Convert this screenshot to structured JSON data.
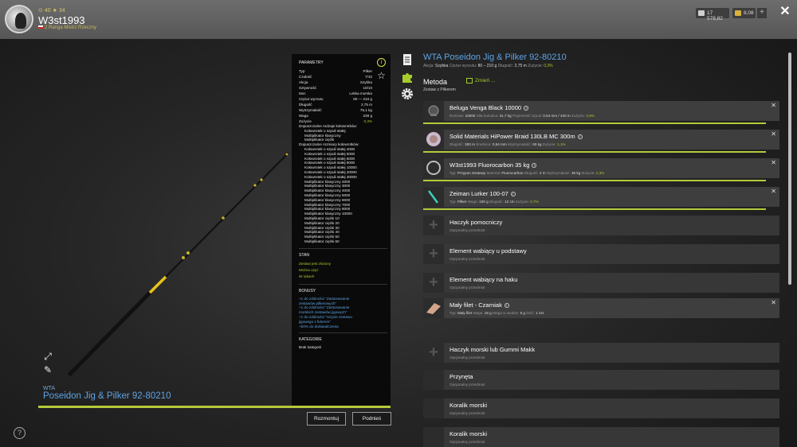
{
  "user": {
    "level_label": "40",
    "stars_label": "34",
    "name": "W3st1993",
    "rank": "2 Ranga Mistrz Rzeczny"
  },
  "currency": {
    "silver": "17 578,82",
    "gold": "8,08",
    "plus": "+"
  },
  "close_label": "✕",
  "rod": {
    "brand": "WTA",
    "name": "Poseidon Jig & Pilker 92-80210"
  },
  "params": {
    "title": "PARAMETRY",
    "rows": [
      {
        "label": "Typ",
        "value": "Pilker"
      },
      {
        "label": "Czułość",
        "value": "7/10"
      },
      {
        "label": "Akcja",
        "value": "Szybka"
      },
      {
        "label": "Sztywność",
        "value": "10/10"
      },
      {
        "label": "Moc",
        "value": "Lekka morska"
      },
      {
        "label": "Ciężar wyrzutu",
        "value": "80 — 210 g"
      },
      {
        "label": "Długość",
        "value": "2,75 m"
      },
      {
        "label": "Wytrzymałość",
        "value": "75,1 kg"
      },
      {
        "label": "Waga",
        "value": "239 g"
      },
      {
        "label": "Zużycie",
        "value": "0,3%",
        "green": true
      }
    ],
    "reels_types_title": "Dopuszczalne rodzaje kołowrotków:",
    "reels_types": [
      "Kołowrotek o szpuli stałej",
      "Multiplikator klasyczny",
      "Multiplikator ciężki"
    ],
    "reels_sizes_title": "Dopuszczalne rozmiary kołowrotków:",
    "reels_sizes": [
      "Kołowrotek o szpuli stałej 4000",
      "Kołowrotek o szpuli stałej 5000",
      "Kołowrotek o szpuli stałej 6000",
      "Kołowrotek o szpuli stałej 8000",
      "Kołowrotek o szpuli stałej 10000",
      "Kołowrotek o szpuli stałej 20000",
      "Kołowrotek o szpuli stałej 30000",
      "Multiplikator klasyczny 2000",
      "Multiplikator klasyczny 3000",
      "Multiplikator klasyczny 4000",
      "Multiplikator klasyczny 5000",
      "Multiplikator klasyczny 6000",
      "Multiplikator klasyczny 7000",
      "Multiplikator klasyczny 8000",
      "Multiplikator klasyczny 10000",
      "Multiplikator ciężki 10",
      "Multiplikator ciężki 20",
      "Multiplikator ciężki 30",
      "Multiplikator ciężki 40",
      "Multiplikator ciężki 50",
      "Multiplikator ciężki 60"
    ],
    "state_title": "STAN",
    "state": [
      "Zestaw jest złożony",
      "Można użyć",
      "W rękach"
    ],
    "bonus_title": "BONUSY",
    "bonus": [
      "+1 do zdolności \"Zastosowanie",
      "zestawów pilkerowych\"",
      "+1 do zdolności \"Zastosowanie",
      "morskich zestawów jigowych\"",
      "+1 do zdolności \"Użycie zestawu",
      "jigowego z fiderem\"",
      "+50% do doświadczenia"
    ],
    "category_title": "KATEGORIE",
    "category": "Brak kategorii"
  },
  "buttons": {
    "disassemble": "Rozmontuj",
    "pick_up": "Podnieś"
  },
  "right": {
    "title": "WTA Poseidon Jig & Pilker 92-80210",
    "sub": {
      "action_label": "Akcja:",
      "action": "Szybka",
      "cast_label": "Ciężar wyrzutu:",
      "cast": "80 – 210 g",
      "len_label": "Długość:",
      "len": "2,75 m",
      "wear_label": "Zużycie:",
      "wear": "0,3%"
    },
    "method_label": "Metoda",
    "change_label": "Zmień ...",
    "method_value": "Zestaw z Pilkerem"
  },
  "slots": [
    {
      "name": "Beluga Venga Black 10000",
      "details": [
        {
          "k": "Rozmiar:",
          "v": "10000"
        },
        {
          "k": "Siła hamulca:",
          "v": "31,7 kg"
        },
        {
          "k": "Pojemność szpuli:",
          "v": "0,54 mm / 430 m"
        },
        {
          "k": "Zużycie:",
          "v": "3,9%",
          "g": true
        }
      ]
    },
    {
      "name": "Solid Materials HiPower Braid 130LB MC 300m",
      "details": [
        {
          "k": "Długość:",
          "v": "300 m"
        },
        {
          "k": "Średnica:",
          "v": "0,54 mm"
        },
        {
          "k": "Wytrzymałość:",
          "v": "60 kg"
        },
        {
          "k": "Zużycie:",
          "v": "1,1%",
          "g": true
        }
      ]
    },
    {
      "name": "W3st1993 Fluorocarbon 35 kg",
      "details": [
        {
          "k": "Typ:",
          "v": "Przypon stratowy"
        },
        {
          "k": "Materiał:",
          "v": "Fluorocarbon"
        },
        {
          "k": "Długość:",
          "v": "2 m"
        },
        {
          "k": "Wytrzymałość:",
          "v": "35 kg"
        },
        {
          "k": "Zużycie:",
          "v": "2,3%",
          "g": true
        }
      ]
    },
    {
      "name": "Zeiman Lurker 100-07",
      "details": [
        {
          "k": "Typ:",
          "v": "Pilker"
        },
        {
          "k": "Waga:",
          "v": "100 g"
        },
        {
          "k": "Długość:",
          "v": "12 cm"
        },
        {
          "k": "Zużycie:",
          "v": "0,7%",
          "g": true
        }
      ]
    },
    {
      "name": "Haczyk pomocniczy",
      "placeholder": "Opcjonalny przedmiot"
    },
    {
      "name": "Element wabiący u podstawy",
      "placeholder": "Opcjonalny przedmiot"
    },
    {
      "name": "Element wabiący na haku",
      "placeholder": "Opcjonalny przedmiot"
    },
    {
      "name": "Mały filet - Czarniak",
      "details": [
        {
          "k": "Typ:",
          "v": "Mały filet"
        },
        {
          "k": "Waga:",
          "v": "15 g"
        },
        {
          "k": "Waga w wodzie:",
          "v": "5 g"
        },
        {
          "k": "Ilość:",
          "v": "1 szt."
        }
      ]
    },
    {
      "name": "Haczyk morski lub Gummi Makk",
      "placeholder": "Opcjonalny przedmiot"
    },
    {
      "name": "Przynęta",
      "placeholder": "Opcjonalny przedmiot"
    },
    {
      "name": "Koralik morski",
      "placeholder": "Opcjonalny przedmiot"
    },
    {
      "name": "Koralik morski",
      "placeholder": "Opcjonalny przedmiot"
    }
  ],
  "help_label": "?",
  "icons": [
    "expand-icon",
    "pencil-icon",
    "info-icon",
    "star-icon",
    "document-icon",
    "puzzle-icon",
    "gear-icon"
  ]
}
